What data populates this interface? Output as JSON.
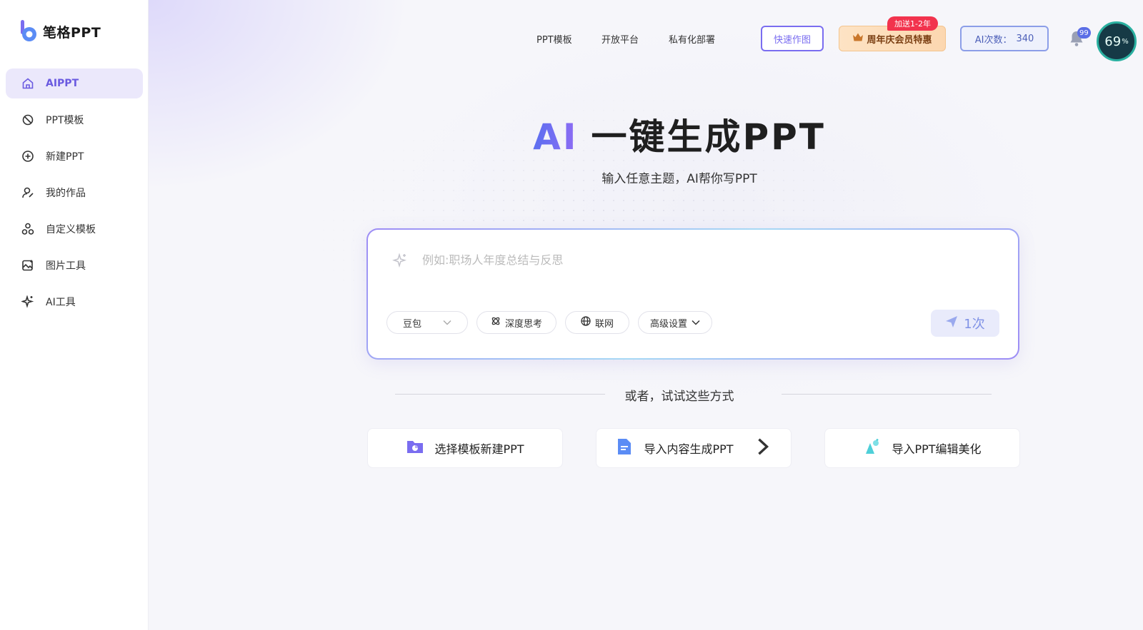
{
  "brand": {
    "name": "笔格PPT"
  },
  "sidebar": {
    "items": [
      {
        "label": "AIPPT",
        "icon": "home-icon",
        "active": true
      },
      {
        "label": "PPT模板",
        "icon": "template-icon"
      },
      {
        "label": "新建PPT",
        "icon": "plus-circle-icon"
      },
      {
        "label": "我的作品",
        "icon": "user-works-icon"
      },
      {
        "label": "自定义模板",
        "icon": "custom-template-icon"
      },
      {
        "label": "图片工具",
        "icon": "image-tool-icon"
      },
      {
        "label": "AI工具",
        "icon": "sparkle-icon"
      }
    ]
  },
  "topnav": {
    "links": [
      "PPT模板",
      "开放平台",
      "私有化部署"
    ],
    "quick_draw": "快速作图",
    "promo_label": "周年庆会员特惠",
    "promo_badge": "加送1-2年",
    "ai_count_label": "AI次数：",
    "ai_count_value": "340",
    "notifications": "99",
    "gauge_value": "69",
    "gauge_unit": "%"
  },
  "hero": {
    "title_ai": "AI",
    "title_rest": "一键生成PPT",
    "subtitle": "输入任意主题，AI帮你写PPT"
  },
  "prompt": {
    "placeholder": "例如:职场人年度总结与反思",
    "value": "",
    "model": "豆包",
    "deep_think": "深度思考",
    "web": "联网",
    "advanced": "高级设置",
    "send_label": "1次"
  },
  "alternatives": {
    "divider_text": "或者，试试这些方式",
    "options": [
      {
        "label": "选择模板新建PPT",
        "icon": "folder-template-icon"
      },
      {
        "label": "导入内容生成PPT",
        "icon": "document-import-icon"
      },
      {
        "label": "导入PPT编辑美化",
        "icon": "magic-beautify-icon"
      }
    ]
  },
  "colors": {
    "accent": "#6a5ae0",
    "accent_light": "#ebe8fb",
    "promo_badge": "#f2334d"
  }
}
